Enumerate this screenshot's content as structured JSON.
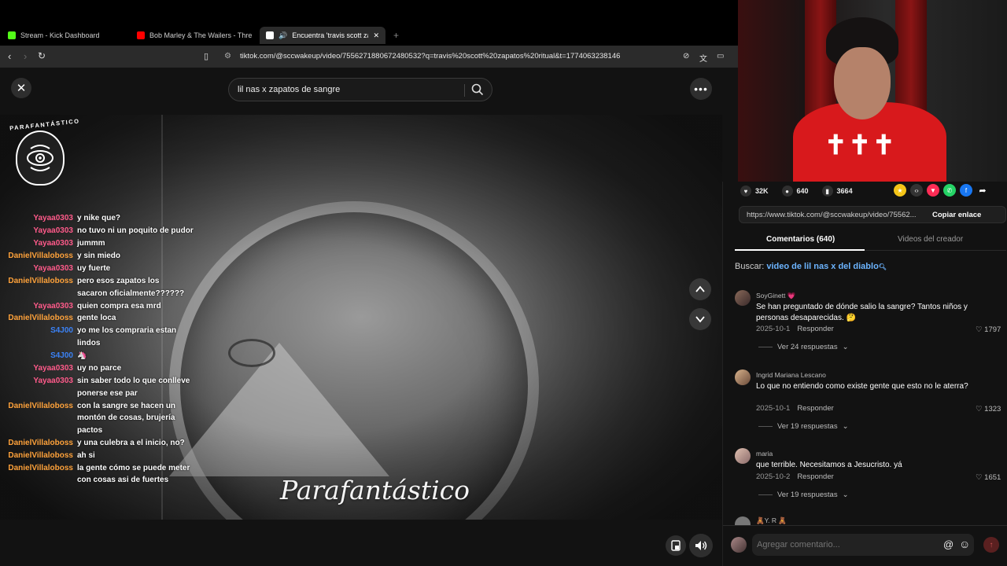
{
  "browser": {
    "tabs": [
      {
        "label": "Stream - Kick Dashboard",
        "favicon_color": "#53fc18"
      },
      {
        "label": "Bob Marley & The Wailers - Three Lit",
        "favicon_color": "#ff0000"
      },
      {
        "label": "Encuentra 'travis scott zapato",
        "favicon_color": "#ffffff",
        "active": true
      }
    ],
    "new_tab": "+",
    "close_tab": "✕",
    "url": "tiktok.com/@sccwakeup/video/7556271880672480532?q=travis%20scott%20zapatos%20ritual&t=1774063238146"
  },
  "search": {
    "query": "lil nas x zapatos de sangre"
  },
  "video": {
    "brand_name": "PARAFANTÁSTICO",
    "watermark": "Parafantástico"
  },
  "chat": [
    {
      "user": "Yayaa0303",
      "color": "#ff5a8a",
      "text": "y nike que?"
    },
    {
      "user": "Yayaa0303",
      "color": "#ff5a8a",
      "text": "no tuvo ni un poquito de pudor"
    },
    {
      "user": "Yayaa0303",
      "color": "#ff5a8a",
      "text": "jummm"
    },
    {
      "user": "DanielVillaloboss",
      "color": "#ffa23a",
      "text": "y sin miedo"
    },
    {
      "user": "Yayaa0303",
      "color": "#ff5a8a",
      "text": "uy fuerte"
    },
    {
      "user": "DanielVillaloboss",
      "color": "#ffa23a",
      "text": "pero esos zapatos los sacaron oficialmente??????"
    },
    {
      "user": "Yayaa0303",
      "color": "#ff5a8a",
      "text": "quien compra esa mrd"
    },
    {
      "user": "DanielVillaloboss",
      "color": "#ffa23a",
      "text": "gente loca"
    },
    {
      "user": "S4J00",
      "color": "#3b82f6",
      "text": "yo me los compraria estan lindos"
    },
    {
      "user": "S4J00",
      "color": "#3b82f6",
      "text": "🦄"
    },
    {
      "user": "Yayaa0303",
      "color": "#ff5a8a",
      "text": "uy no parce"
    },
    {
      "user": "Yayaa0303",
      "color": "#ff5a8a",
      "text": "sin saber todo lo que conlleve ponerse ese par"
    },
    {
      "user": "DanielVillaloboss",
      "color": "#ffa23a",
      "text": "con la sangre se hacen un montón de cosas, brujería pactos"
    },
    {
      "user": "DanielVillaloboss",
      "color": "#ffa23a",
      "text": "y una culebra a el inicio, no?"
    },
    {
      "user": "DanielVillaloboss",
      "color": "#ffa23a",
      "text": "ah si"
    },
    {
      "user": "DanielVillaloboss",
      "color": "#ffa23a",
      "text": "la gente cómo se puede meter con cosas asi de fuertes"
    }
  ],
  "stats": {
    "likes": "32K",
    "comments": "640",
    "saves": "3664"
  },
  "share": {
    "link": "https://www.tiktok.com/@sccwakeup/video/75562...",
    "copy_label": "Copiar enlace"
  },
  "panel_tabs": {
    "comments": "Comentarios (640)",
    "creator": "Videos del creador"
  },
  "buscar": {
    "label": "Buscar:",
    "query": "video de lil nas x del diablo"
  },
  "comments": [
    {
      "name": "SoyGinett 💗",
      "body": "Se han preguntado de dónde salio la sangre? Tantos niños y personas desaparecidas. 🤔",
      "date": "2025-10-1",
      "reply": "Responder",
      "likes": "1797",
      "replies": "Ver 24 respuestas"
    },
    {
      "name": "Ingrid Mariana Lescano",
      "body": "Lo que no entiendo como existe gente que esto no le aterra?",
      "date": "2025-10-1",
      "reply": "Responder",
      "likes": "1323",
      "replies": "Ver 19 respuestas"
    },
    {
      "name": "maria",
      "body": "que terrible. Necesitamos a Jesucristo. yá",
      "date": "2025-10-2",
      "reply": "Responder",
      "likes": "1651",
      "replies": "Ver 19 respuestas"
    },
    {
      "name": "🧸Y. R 🧸"
    }
  ],
  "comment_input": {
    "placeholder": "Agregar comentario..."
  },
  "colors": {
    "accent": "#fe2c55",
    "link": "#6cb4ff",
    "background": "#121212"
  }
}
